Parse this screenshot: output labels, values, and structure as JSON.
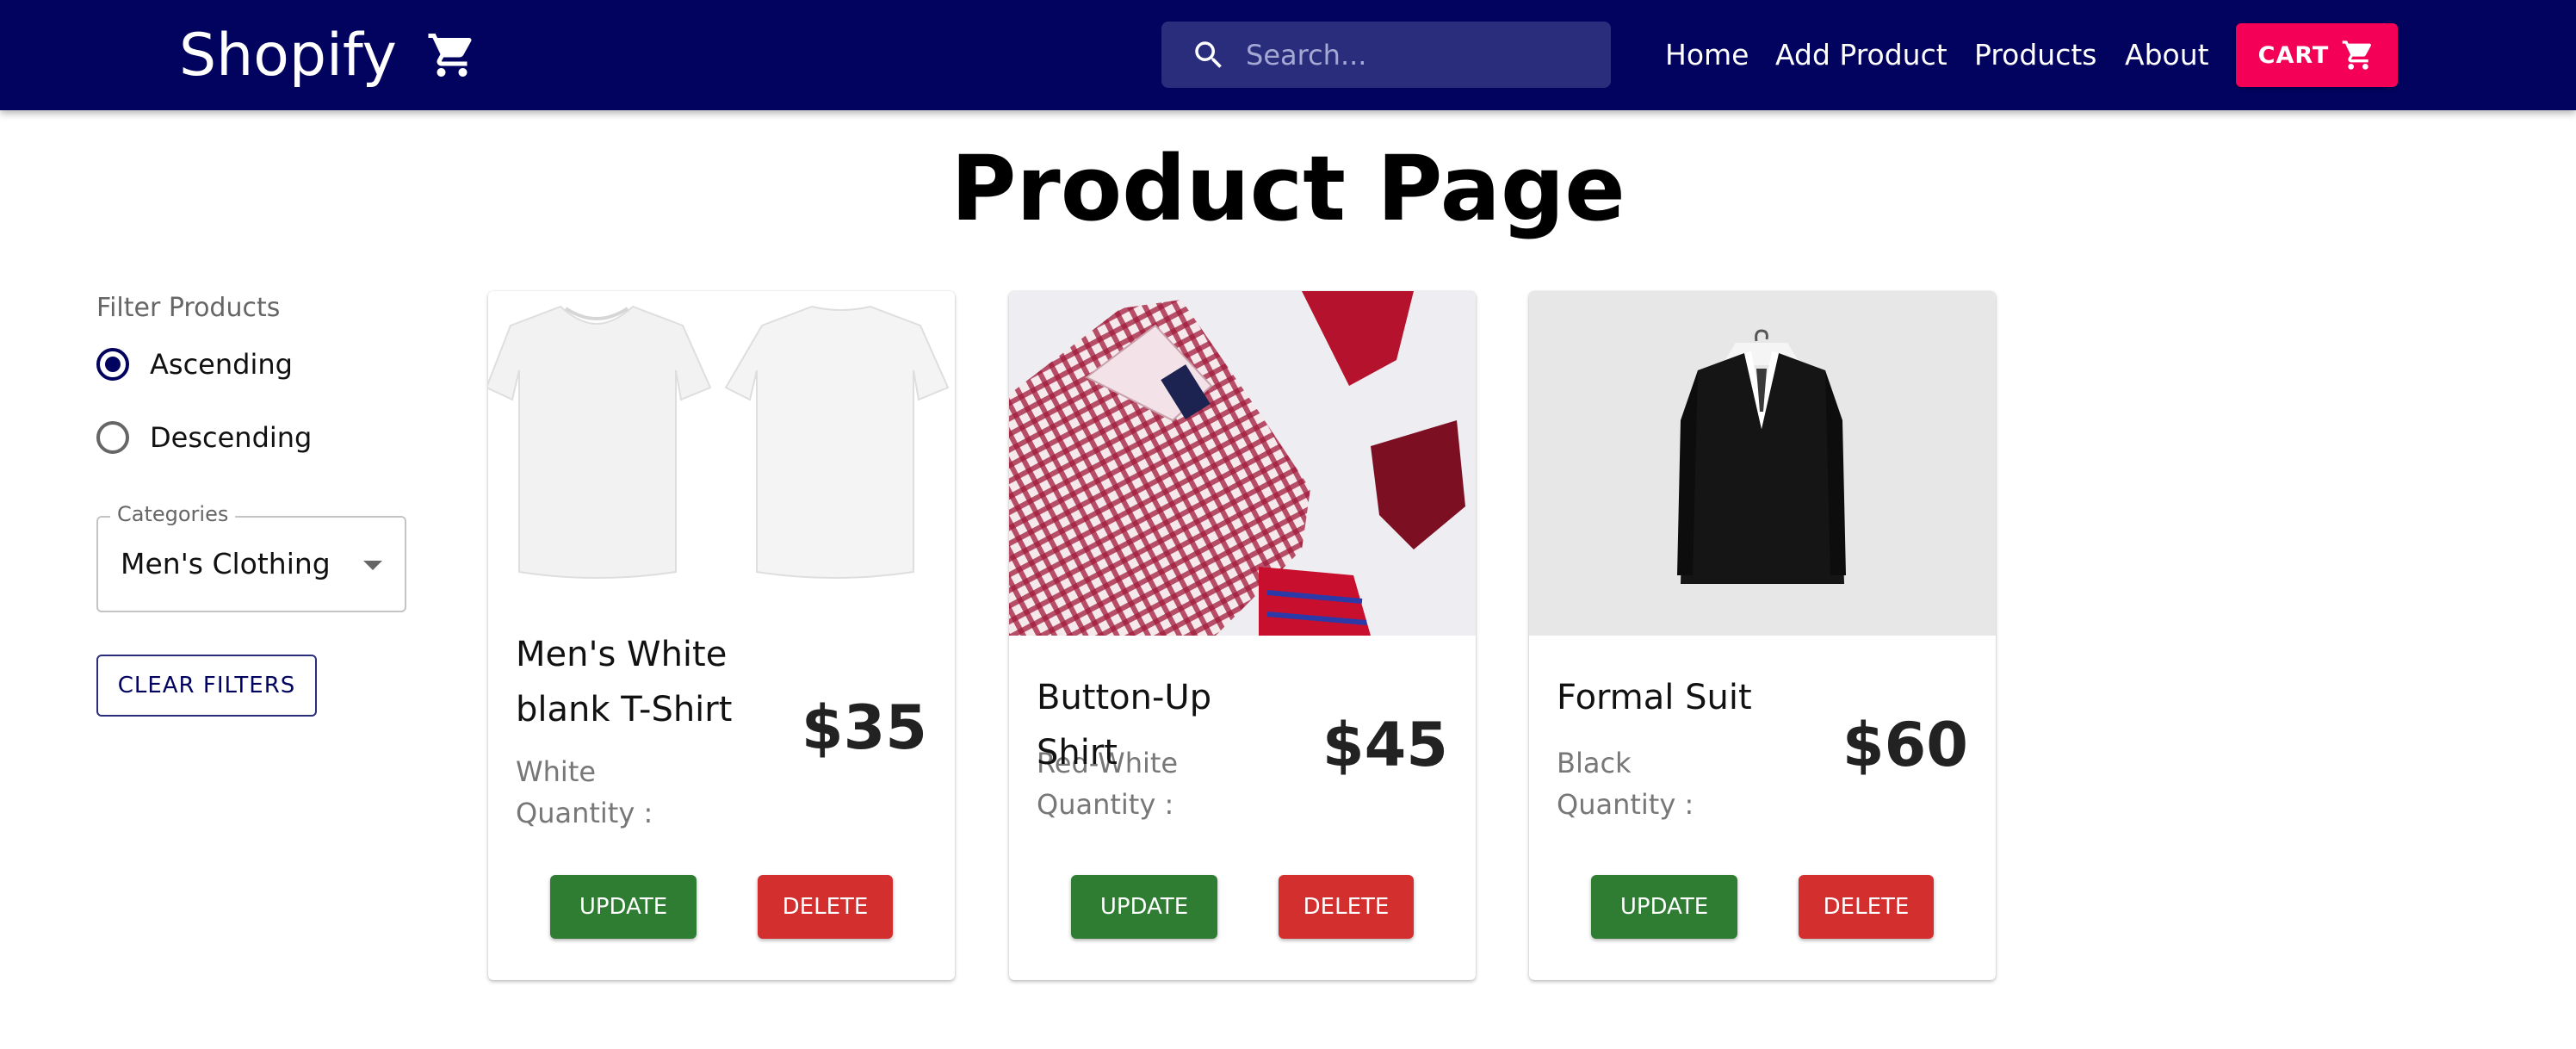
{
  "navbar": {
    "brand": "Shopify",
    "brand_icon": "cart-icon",
    "search_placeholder": "Search...",
    "links": [
      "Home",
      "Add Product",
      "Products",
      "About"
    ],
    "cart_label": "CART",
    "colors": {
      "background": "#02035f",
      "cart_button": "#f50057"
    }
  },
  "page": {
    "title": "Product Page"
  },
  "filters": {
    "heading": "Filter Products",
    "sort_options": [
      {
        "label": "Ascending",
        "checked": true
      },
      {
        "label": "Descending",
        "checked": false
      }
    ],
    "categories_label": "Categories",
    "categories_value": "Men's Clothing",
    "clear_label": "CLEAR FILTERS"
  },
  "products": [
    {
      "name": "Men's White blank T-Shirt",
      "color": "White",
      "quantity_label": "Quantity :",
      "price": "$35",
      "update_label": "UPDATE",
      "delete_label": "DELETE"
    },
    {
      "name": "Button-Up Shirt",
      "color": "Red-White",
      "quantity_label": "Quantity :",
      "price": "$45",
      "update_label": "UPDATE",
      "delete_label": "DELETE"
    },
    {
      "name": "Formal Suit",
      "color": "Black",
      "quantity_label": "Quantity :",
      "price": "$60",
      "update_label": "UPDATE",
      "delete_label": "DELETE"
    }
  ],
  "button_colors": {
    "update": "#2e7d32",
    "delete": "#d32f2f"
  }
}
